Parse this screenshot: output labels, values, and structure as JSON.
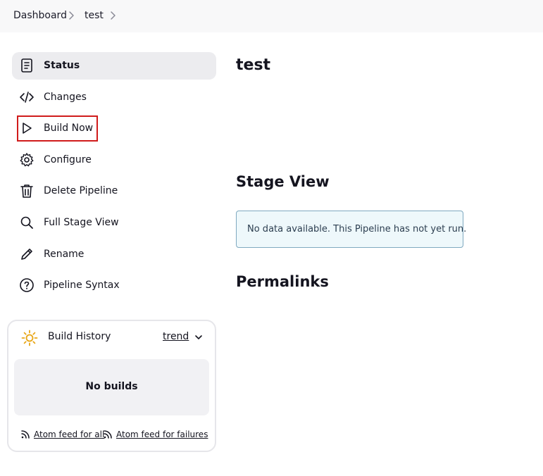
{
  "breadcrumb": {
    "items": [
      "Dashboard",
      "test"
    ]
  },
  "sidebar": {
    "items": [
      {
        "label": "Status",
        "icon": "document-icon",
        "active": true
      },
      {
        "label": "Changes",
        "icon": "code-icon"
      },
      {
        "label": "Build Now",
        "icon": "play-icon"
      },
      {
        "label": "Configure",
        "icon": "gear-icon"
      },
      {
        "label": "Delete Pipeline",
        "icon": "trash-icon"
      },
      {
        "label": "Full Stage View",
        "icon": "search-icon"
      },
      {
        "label": "Rename",
        "icon": "pencil-icon"
      },
      {
        "label": "Pipeline Syntax",
        "icon": "help-icon"
      }
    ]
  },
  "build_history": {
    "title": "Build History",
    "trend_label": "trend",
    "empty_label": "No builds",
    "feed_all": "Atom feed for all",
    "feed_failures": "Atom feed for failures"
  },
  "main": {
    "title": "test",
    "stage_view_heading": "Stage View",
    "stage_view_notice": "No data available. This Pipeline has not yet run.",
    "permalinks_heading": "Permalinks"
  },
  "colors": {
    "highlight": "#d01b1b",
    "notice_bg": "#eef8fb",
    "notice_border": "#7fa9c0",
    "sun": "#e8a617"
  }
}
